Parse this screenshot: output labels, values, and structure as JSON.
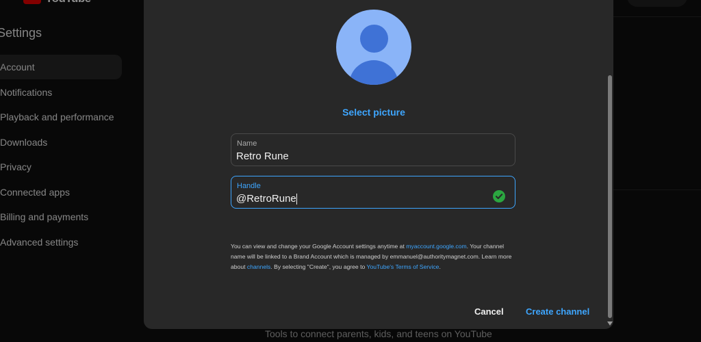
{
  "app": {
    "logo_text": "YouTube",
    "brand_color": "#ff0000"
  },
  "settings": {
    "title": "Settings",
    "nav": [
      {
        "label": "Account",
        "active": true
      },
      {
        "label": "Notifications"
      },
      {
        "label": "Playback and performance"
      },
      {
        "label": "Downloads"
      },
      {
        "label": "Privacy"
      },
      {
        "label": "Connected apps"
      },
      {
        "label": "Billing and payments"
      },
      {
        "label": "Advanced settings"
      }
    ],
    "background_text": "Tools to connect parents, kids, and teens on YouTube"
  },
  "dialog": {
    "select_picture": "Select picture",
    "name_field": {
      "label": "Name",
      "value": "Retro Rune"
    },
    "handle_field": {
      "label": "Handle",
      "value": "@RetroRune",
      "valid": true
    },
    "legal": {
      "part1": "You can view and change your Google Account settings anytime at ",
      "link1": "myaccount.google.com",
      "part2": ". Your channel name will be linked to a Brand Account which is managed by emmanuel@authoritymagnet.com. Learn more about ",
      "link2": "channels",
      "part3": ". By selecting \"Create\", you agree to ",
      "link3": "YouTube's Terms of Service",
      "part4": "."
    },
    "cancel_label": "Cancel",
    "create_label": "Create channel"
  },
  "colors": {
    "accent": "#3ea6ff",
    "dialog_bg": "#282828",
    "page_bg": "#0f0f0f",
    "valid_check": "#2ba640",
    "avatar_bg": "#8ab4f8",
    "avatar_figure": "#3f72d6"
  }
}
